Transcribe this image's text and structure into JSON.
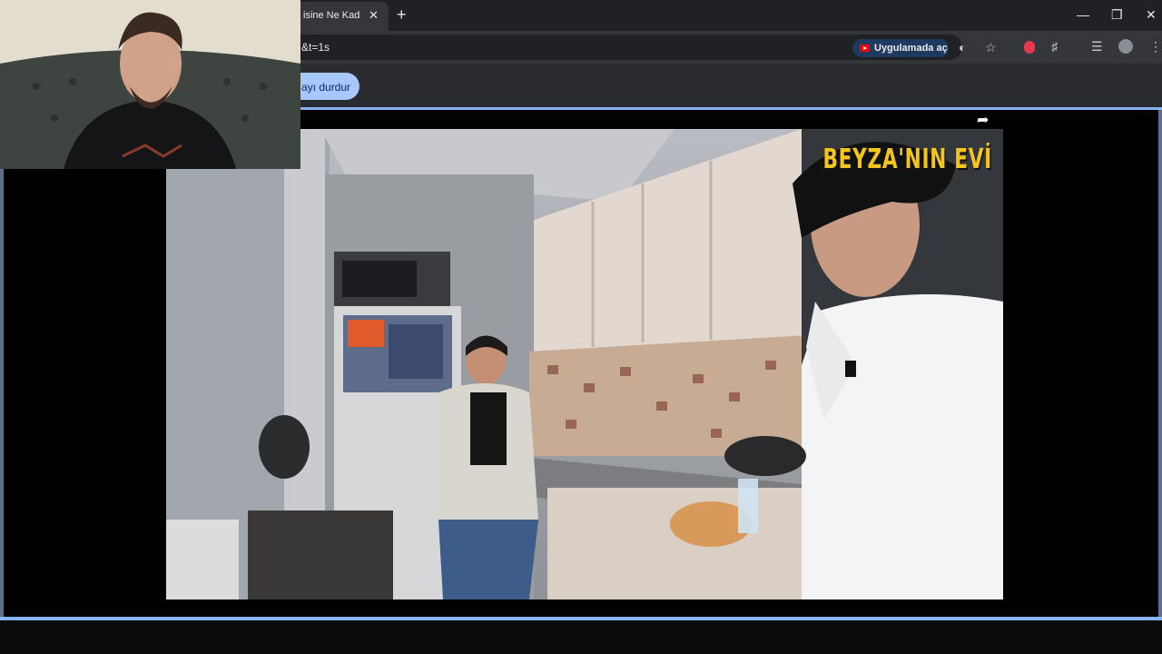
{
  "browser": {
    "tab_title": "isine Ne Kadar",
    "url": "&t=1s",
    "open_in_app": "Uygulamada aç",
    "new_tab": "+",
    "tab_close": "✕"
  },
  "page": {
    "pause_chip": "ayı durdur"
  },
  "video": {
    "caption": "BEYZA'NIN EVİ"
  },
  "icons": {
    "share": "share-icon",
    "youtube": "youtube-icon",
    "eye_off": "eye-off-icon",
    "star": "star-icon",
    "extensions": "extensions-icon",
    "media": "media-control-icon",
    "menu": "kebab-menu-icon",
    "minimize": "minimize-icon",
    "restore": "restore-icon",
    "close": "close-icon"
  },
  "colors": {
    "accent": "#8ab4f8",
    "chip": "#a8c7fa",
    "caption": "#f5c518",
    "record": "#e8384f"
  }
}
